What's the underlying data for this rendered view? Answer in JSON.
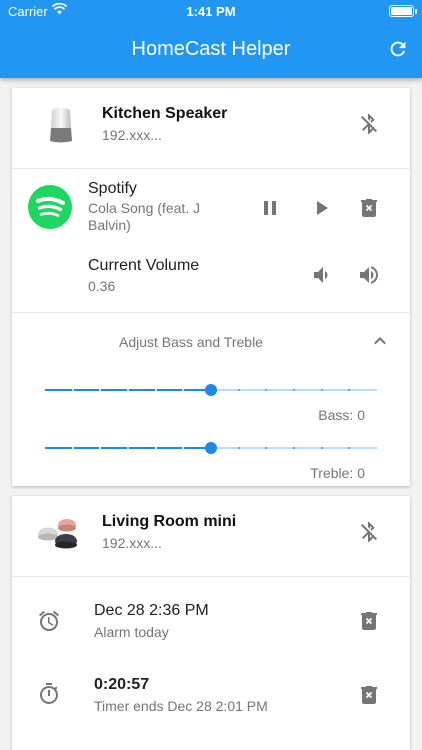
{
  "status_bar": {
    "carrier": "Carrier",
    "time": "1:41 PM"
  },
  "app": {
    "title": "HomeCast Helper",
    "refresh_icon": "refresh-icon",
    "accent": "#2196f3"
  },
  "kitchen": {
    "name": "Kitchen Speaker",
    "ip": "192.xxx...",
    "bluetooth_icon": "bluetooth-disabled-icon",
    "media": {
      "app": "Spotify",
      "song": "Cola Song (feat. J Balvin)",
      "pause_icon": "pause-icon",
      "play_icon": "play-icon",
      "delete_icon": "delete-icon"
    },
    "volume": {
      "label": "Current Volume",
      "value": "0.36"
    },
    "eq": {
      "header": "Adjust Bass and Treble",
      "bass_label": "Bass: 0",
      "bass_level": 0.5,
      "treble_label": "Treble: 0",
      "treble_level": 0.5,
      "divisions": 12
    }
  },
  "living_room": {
    "name": "Living Room mini",
    "ip": "192.xxx...",
    "alarm": {
      "time": "Dec 28 2:36 PM",
      "subtitle": "Alarm today"
    },
    "timer": {
      "time": "0:20:57",
      "subtitle": "Timer ends Dec 28 2:01 PM"
    }
  }
}
